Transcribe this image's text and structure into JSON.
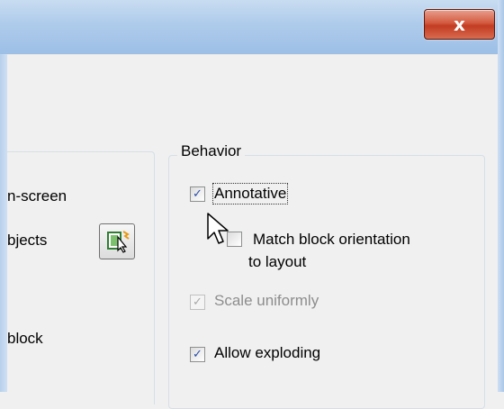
{
  "titlebar": {
    "close_label": "x"
  },
  "left_panel": {
    "line1": "n-screen",
    "line2": "bjects",
    "line3": "block"
  },
  "behavior": {
    "title": "Behavior",
    "annotative": {
      "label": "Annotative",
      "checked": true
    },
    "match_orientation": {
      "label_line1": "Match block orientation",
      "label_line2": "to layout",
      "checked": false
    },
    "scale_uniformly": {
      "label": "Scale uniformly",
      "checked": true,
      "disabled": true
    },
    "allow_exploding": {
      "label": "Allow exploding",
      "checked": true
    }
  },
  "icons": {
    "close": "close-icon",
    "pick": "pick-objects-icon",
    "cursor": "mouse-pointer-icon"
  },
  "colors": {
    "titlebar": "#aecbeb",
    "close_button": "#c23c22",
    "check_mark": "#2b4ea8"
  }
}
